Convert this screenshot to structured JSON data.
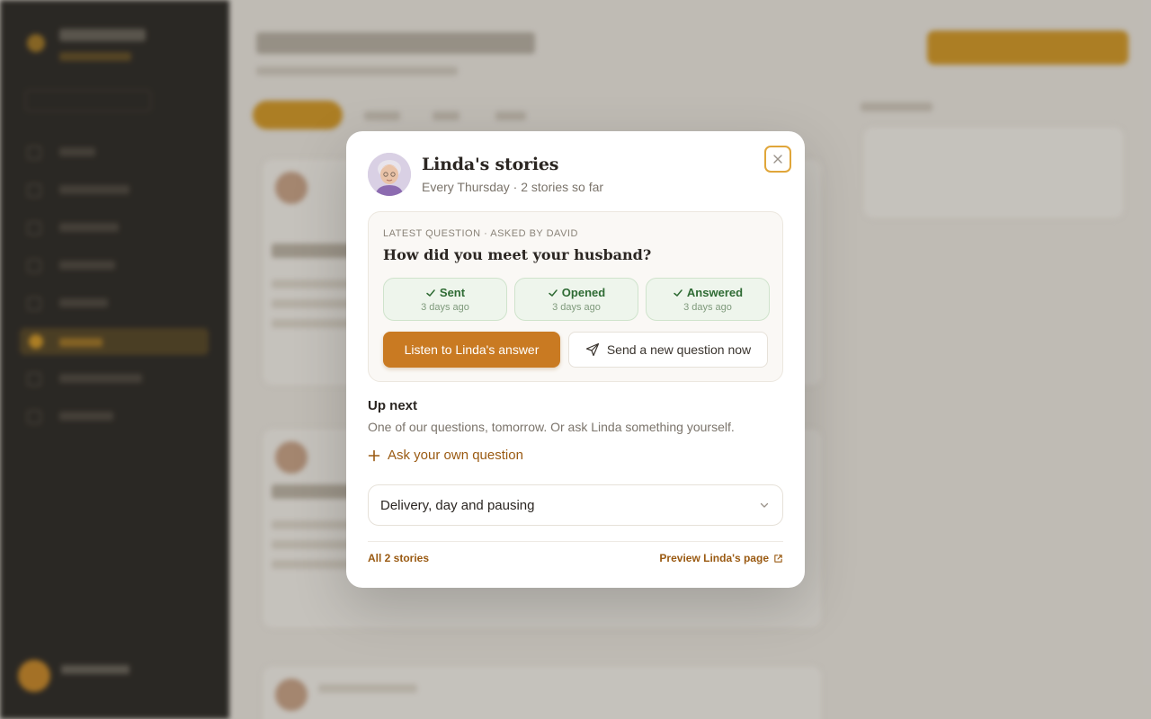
{
  "modal": {
    "title": "Linda's stories",
    "subtitle": "Every Thursday · 2 stories so far",
    "latest_label": "LATEST QUESTION · ASKED BY DAVID",
    "question": "How did you meet your husband?",
    "steps": [
      {
        "label": "Sent",
        "when": "3 days ago"
      },
      {
        "label": "Opened",
        "when": "3 days ago"
      },
      {
        "label": "Answered",
        "when": "3 days ago"
      }
    ],
    "listen_button": "Listen to Linda's answer",
    "send_button": "Send a new question now",
    "up_next": {
      "heading": "Up next",
      "description": "One of our questions, tomorrow. Or ask Linda something yourself.",
      "ask_link": "Ask your own question"
    },
    "accordion_label": "Delivery, day and pausing",
    "footer": {
      "all_stories": "All 2 stories",
      "preview": "Preview Linda's page"
    }
  },
  "colors": {
    "accent": "#c97a22",
    "link": "#9a5a12",
    "success_bg": "#eef5ec",
    "success_text": "#2f6b34"
  },
  "icons": [
    "close-icon",
    "check-icon",
    "send-icon",
    "plus-icon",
    "chevron-down-icon",
    "external-link-icon"
  ]
}
